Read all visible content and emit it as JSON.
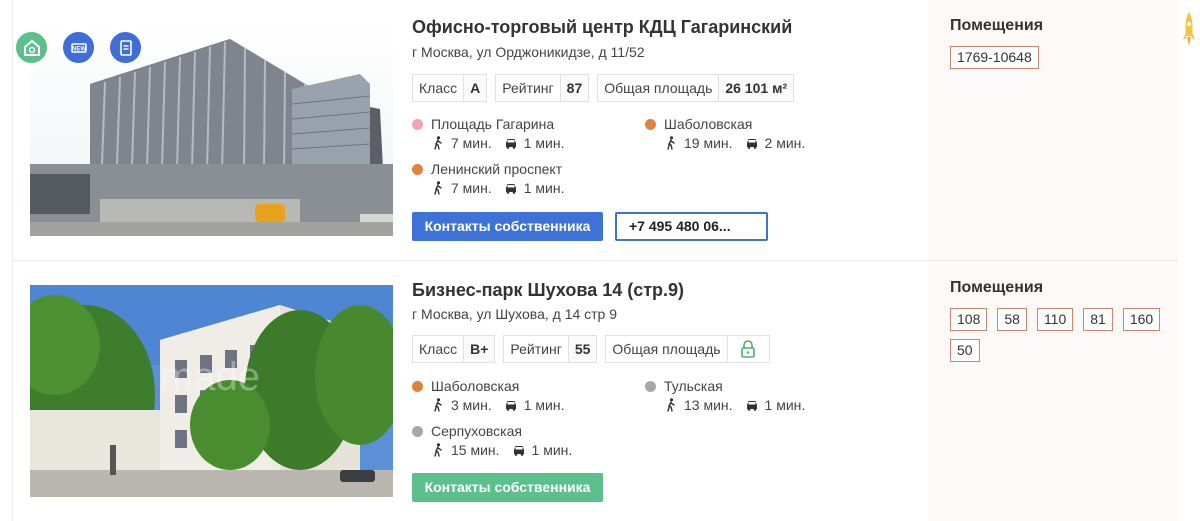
{
  "listings": [
    {
      "title": "Офисно-торговый центр КДЦ Гагаринский",
      "address": "г Москва, ул Орджоникидзе, д 11/52",
      "badges": [
        "house-search-icon",
        "new-icon",
        "document-icon"
      ],
      "params": {
        "class_label": "Класс",
        "class_value": "A",
        "rating_label": "Рейтинг",
        "rating_value": "87",
        "area_label": "Общая площадь",
        "area_value": "26 101 м²"
      },
      "metro": [
        {
          "name": "Площадь Гагарина",
          "color": "#f2a5b0",
          "walk": "7 мин.",
          "car": "1 мин."
        },
        {
          "name": "Шаболовская",
          "color": "#e0823b",
          "walk": "19 мин.",
          "car": "2 мин."
        },
        {
          "name": "Ленинский проспект",
          "color": "#e0823b",
          "walk": "7 мин.",
          "car": "1 мин."
        }
      ],
      "contacts_button": "Контакты собственника",
      "phone_button": "+7 495 480 06...",
      "rooms_title": "Помещения",
      "rooms": [
        "1769-10648"
      ]
    },
    {
      "title": "Бизнес-парк Шухова 14 (стр.9)",
      "address": "г Москва, ул Шухова, д 14 стр 9",
      "params": {
        "class_label": "Класс",
        "class_value": "B+",
        "rating_label": "Рейтинг",
        "rating_value": "55",
        "area_label": "Общая площадь",
        "area_locked": "lock-icon"
      },
      "metro": [
        {
          "name": "Шаболовская",
          "color": "#e0823b",
          "walk": "3 мин.",
          "car": "1 мин."
        },
        {
          "name": "Тульская",
          "color": "#a8a8a8",
          "walk": "13 мин.",
          "car": "1 мин."
        },
        {
          "name": "Серпуховская",
          "color": "#a8a8a8",
          "walk": "15 мин.",
          "car": "1 мин."
        }
      ],
      "contacts_button": "Контакты собственника",
      "rooms_title": "Помещения",
      "rooms": [
        "108",
        "58",
        "110",
        "81",
        "160",
        "50"
      ]
    }
  ],
  "colors": {
    "primary_button": "#3e72d6",
    "green_button": "#5cc08d",
    "room_tag_border": "#d9826b",
    "side_background": "#fcf9f8"
  }
}
